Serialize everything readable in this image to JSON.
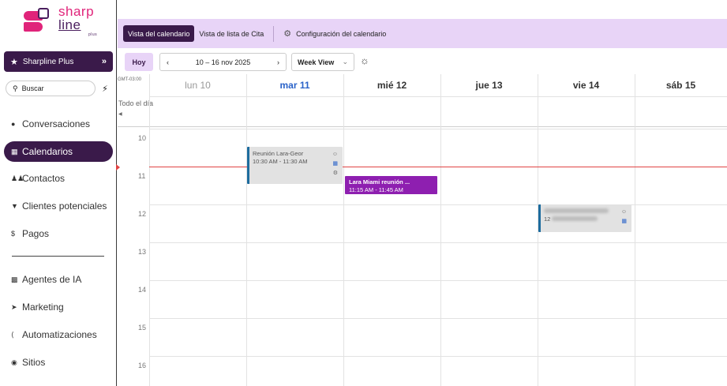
{
  "brand": {
    "line1": "sharp",
    "line2": "line",
    "sub": "plus"
  },
  "account": {
    "name": "Sharpline Plus",
    "chevron": "»"
  },
  "search": {
    "placeholder": "Buscar"
  },
  "nav": [
    {
      "label": "Conversaciones",
      "icon": "chat-icon"
    },
    {
      "label": "Calendarios",
      "icon": "calendar-icon",
      "active": true
    },
    {
      "label": "Contactos",
      "icon": "contacts-icon"
    },
    {
      "label": "Clientes potenciales",
      "icon": "filter-icon"
    },
    {
      "label": "Pagos",
      "icon": "dollar-icon"
    },
    {
      "label": "Agentes de IA",
      "icon": "robot-icon"
    },
    {
      "label": "Marketing",
      "icon": "megaphone-icon"
    },
    {
      "label": "Automatizaciones",
      "icon": "workflow-icon"
    },
    {
      "label": "Sitios",
      "icon": "globe-icon"
    }
  ],
  "tabs": {
    "calendar_view": "Vista del calendario",
    "list_view": "Vista de lista de Cita",
    "settings": "Configuración del calendario"
  },
  "toolbar": {
    "today": "Hoy",
    "range": "10 – 16 nov 2025",
    "view": "Week View"
  },
  "calendar": {
    "timezone": "GMT-03:00",
    "all_day": "Todo el día",
    "days": [
      {
        "label": "lun 10",
        "state": "past"
      },
      {
        "label": "mar 11",
        "state": "today"
      },
      {
        "label": "mié 12",
        "state": "normal"
      },
      {
        "label": "jue 13",
        "state": "normal"
      },
      {
        "label": "vie 14",
        "state": "normal"
      },
      {
        "label": "sáb 15",
        "state": "normal"
      }
    ],
    "hours": [
      "10",
      "11",
      "12",
      "13",
      "14",
      "15",
      "16"
    ],
    "events": [
      {
        "title": "Reunión Lara-Geor",
        "time": "10:30 AM - 11:30 AM",
        "day": "mar 11"
      },
      {
        "title": "Lara Miami reunión ...",
        "time": "11:15 AM - 11:45 AM",
        "day": "mié 12",
        "color": "#8e1fb0"
      },
      {
        "title": "",
        "time": "12",
        "day": "vie 14",
        "blurred": true
      }
    ]
  },
  "colors": {
    "accent": "#3a1a4a",
    "accent_light": "#e8d4f7",
    "brand_pink": "#e0247a",
    "event_purple": "#8e1fb0",
    "now_line": "#e04444"
  }
}
